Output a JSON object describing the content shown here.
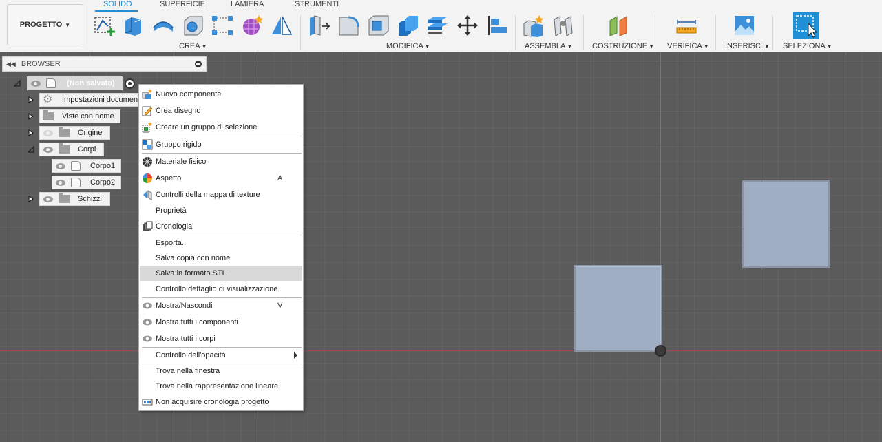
{
  "toolbar": {
    "project_button": "PROGETTO",
    "tabs": [
      "SOLIDO",
      "SUPERFICIE",
      "LAMIERA",
      "STRUMENTI"
    ],
    "active_tab": "SOLIDO",
    "groups": [
      "CREA",
      "MODIFICA",
      "ASSEMBLA",
      "COSTRUZIONE",
      "VERIFICA",
      "INSERISCI",
      "SELEZIONA"
    ],
    "accent_color": "#1f8fd6"
  },
  "browser": {
    "title": "BROWSER",
    "root": "(Non salvato)",
    "nodes": [
      "Impostazioni document",
      "Viste con nome",
      "Origine",
      "Corpi",
      "Corpo1",
      "Corpo2",
      "Schizzi"
    ]
  },
  "context_menu": {
    "items": [
      {
        "label": "Nuovo componente",
        "icon": "new-component-icon"
      },
      {
        "label": "Crea disegno",
        "icon": "create-drawing-icon"
      },
      {
        "label": "Creare un gruppo di selezione",
        "icon": "selection-group-icon"
      },
      {
        "label": "Gruppo rigido",
        "icon": "rigid-group-icon"
      },
      {
        "label": "Materiale fisico",
        "icon": "physical-material-icon"
      },
      {
        "label": "Aspetto",
        "icon": "appearance-icon",
        "shortcut": "A"
      },
      {
        "label": "Controlli della mappa di texture",
        "icon": "texture-map-icon"
      },
      {
        "label": "Proprietà",
        "icon": ""
      },
      {
        "label": "Cronologia",
        "icon": "history-icon"
      },
      {
        "label": "Esporta...",
        "icon": ""
      },
      {
        "label": "Salva copia con nome",
        "icon": ""
      },
      {
        "label": "Salva in formato STL",
        "icon": ""
      },
      {
        "label": "Controllo dettaglio di visualizzazione",
        "icon": ""
      },
      {
        "label": "Mostra/Nascondi",
        "icon": "eye-icon",
        "shortcut": "V"
      },
      {
        "label": "Mostra tutti i componenti",
        "icon": "eye-icon"
      },
      {
        "label": "Mostra tutti i corpi",
        "icon": "eye-icon"
      },
      {
        "label": "Controllo dell'opacità",
        "icon": ""
      },
      {
        "label": "Trova nella finestra",
        "icon": ""
      },
      {
        "label": "Trova nella rappresentazione lineare",
        "icon": ""
      },
      {
        "label": "Non acquisire cronologia progetto",
        "icon": "no-history-icon"
      }
    ],
    "hovered_item": "Salva in formato STL"
  }
}
